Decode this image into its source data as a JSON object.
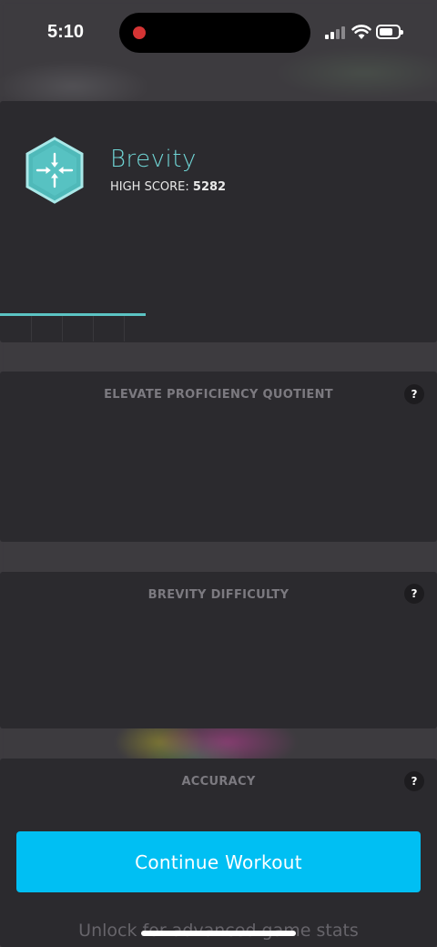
{
  "status_bar": {
    "time": "5:10",
    "recording_indicator_color": "#d43434",
    "signal_icon": "cellular-signal-icon",
    "wifi_icon": "wifi-icon",
    "battery_icon": "battery-icon"
  },
  "game": {
    "name": "Brevity",
    "high_score_label": "HIGH SCORE:",
    "high_score_value": "5282",
    "icon": "brevity-hexagon-icon",
    "accent_color": "#6fd4d4"
  },
  "metrics": [
    {
      "title": "ELEVATE PROFICIENCY QUOTIENT",
      "help_label": "?"
    },
    {
      "title": "BREVITY DIFFICULTY",
      "help_label": "?"
    },
    {
      "title": "ACCURACY",
      "help_label": "?"
    }
  ],
  "cta": {
    "label": "Continue Workout",
    "color": "#00bff3"
  },
  "footer": {
    "unlock_text": "Unlock for advanced game stats"
  }
}
